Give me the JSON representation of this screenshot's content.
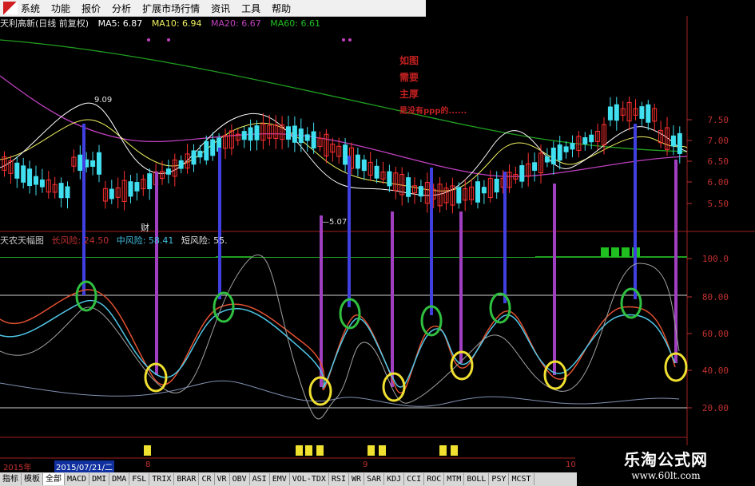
{
  "menu": [
    "系统",
    "功能",
    "报价",
    "分析",
    "扩展市场行情",
    "资讯",
    "工具",
    "帮助"
  ],
  "price_title": {
    "stock": "天利高新(日线 前复权)",
    "ma5": "MA5: 6.87",
    "ma10": "MA10: 6.94",
    "ma20": "MA20: 6.67",
    "ma60": "MA60: 6.61"
  },
  "price_axis": [
    "7.50",
    "7.00",
    "6.50",
    "6.00",
    "5.50"
  ],
  "price_annotations": {
    "high": "9.09",
    "low": "5.07",
    "mark": "财"
  },
  "note": [
    "如图",
    "需要",
    "主厚",
    "是没有ppp的......"
  ],
  "indicator": {
    "title": "天农天幅图",
    "long": "长风险: 24.50",
    "mid": "中风险: 58.41",
    "short": "短风险: 55."
  },
  "indicator_axis": [
    "100.0",
    "80.00",
    "60.00",
    "40.00",
    "20.00"
  ],
  "dates": {
    "year": "2015年",
    "selected": "2015/07/21/二",
    "m8": "8",
    "m9": "9",
    "m10": "10"
  },
  "tabs": [
    "指标",
    "模板",
    "全部",
    "MACD",
    "DMI",
    "DMA",
    "FSL",
    "TRIX",
    "BRAR",
    "CR",
    "VR",
    "OBV",
    "ASI",
    "EMV",
    "VOL-TDX",
    "RSI",
    "WR",
    "SAR",
    "KDJ",
    "CCI",
    "ROC",
    "MTM",
    "BOLL",
    "PSY",
    "MCST"
  ],
  "watermark": {
    "name": "乐淘公式网",
    "url": "www.60lt.com"
  },
  "colors": {
    "up": "#ff3030",
    "down": "#40e0f0",
    "ma5": "#ffffff",
    "ma10": "#f0f060",
    "ma20": "#c040c0",
    "ma60": "#20a020",
    "signal_buy": "#4040e0",
    "signal_sell": "#a040c0",
    "ring_top": "#30c040",
    "ring_bottom": "#f0e030"
  }
}
